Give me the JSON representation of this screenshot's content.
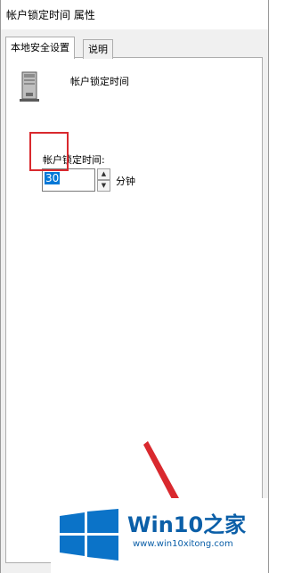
{
  "window": {
    "title": "帐户锁定时间 属性"
  },
  "tabs": [
    {
      "label": "本地安全设置",
      "active": true
    },
    {
      "label": "说明",
      "active": false
    }
  ],
  "policy": {
    "name": "帐户锁定时间",
    "icon": "server-icon"
  },
  "setting": {
    "label": "帐户锁定时间:",
    "value": "30",
    "unit": "分钟"
  },
  "watermark": {
    "brand": "Win10之家",
    "url": "www.win10xitong.com"
  },
  "colors": {
    "selection": "#0078d7",
    "annotation": "#d9292e",
    "brand": "#0b5fa8"
  }
}
